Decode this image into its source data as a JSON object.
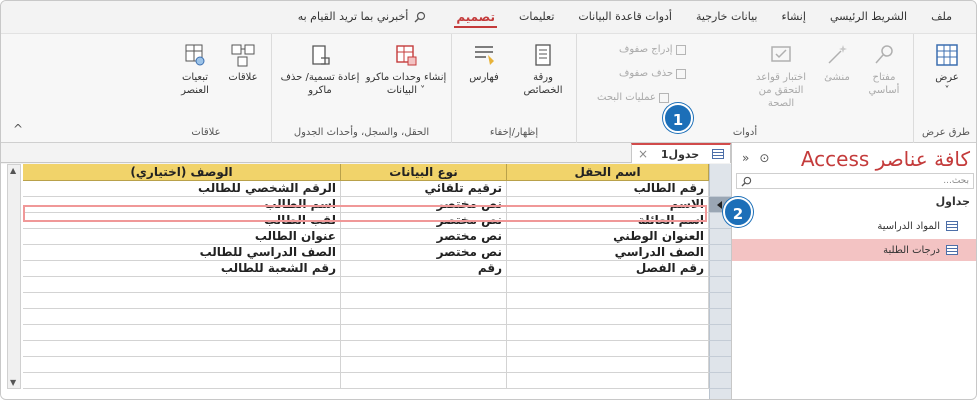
{
  "tabs": {
    "file": "ملف",
    "home": "الشريط الرئيسي",
    "create": "إنشاء",
    "external": "بيانات خارجية",
    "dbtools": "أدوات قاعدة البيانات",
    "help": "تعليمات",
    "design": "تصميم",
    "tell_me": "أخبرني بما تريد القيام به"
  },
  "ribbon": {
    "views": {
      "view": "عرض",
      "group": "طرق عرض"
    },
    "tools": {
      "primary_key": "مفتاح أساسي",
      "builder": "منشئ",
      "test_rules": "اختبار قواعد التحقق من الصحة",
      "insert_rows": "إدراج صفوف",
      "delete_rows": "حذف صفوف",
      "modify_lookups": "عمليات البحث",
      "group": "أدوات"
    },
    "show_hide": {
      "property_sheet": "ورقة الخصائص",
      "indexes": "فهارس",
      "group": "إظهار/إخفاء"
    },
    "field_events": {
      "create_macros": "إنشاء وحدات ماكرو البيانات",
      "rename_macro": "إعادة تسمية/ حذف ماكرو",
      "group": "الحقل، والسجل، وأحداث الجدول"
    },
    "relationships": {
      "relationships": "علاقات",
      "dependencies": "تبعيات العنصر",
      "group": "علاقات"
    }
  },
  "doc_tab": {
    "label": "جدول1"
  },
  "table": {
    "headers": {
      "field_name": "اسم الحقل",
      "data_type": "نوع البيانات",
      "description": "الوصف (اختياري)"
    },
    "rows": [
      {
        "field": "رقم الطالب",
        "type": "ترقيم تلقائي",
        "desc": "الرقم الشخصي للطالب"
      },
      {
        "field": "الاسم",
        "type": "نص مختصر",
        "desc": "اسم الطالب"
      },
      {
        "field": "اسم العائلة",
        "type": "نص مختصر",
        "desc": "لقب الطالب"
      },
      {
        "field": "العنوان الوطني",
        "type": "نص مختصر",
        "desc": "عنوان الطالب"
      },
      {
        "field": "الصف الدراسي",
        "type": "نص مختصر",
        "desc": "الصف الدراسي للطالب"
      },
      {
        "field": "رقم الفصل",
        "type": "رقم",
        "desc": "رقم الشعبة للطالب"
      }
    ]
  },
  "nav": {
    "title": "كافة عناصر Access",
    "search_placeholder": "بحث...",
    "section": "جداول",
    "items": [
      "المواد الدراسية",
      "درجات الطلبة"
    ]
  },
  "callouts": [
    "1",
    "2"
  ],
  "colors": {
    "accent": "#c43b3b",
    "header": "#f1d36a",
    "callout": "#1c6fb8",
    "selected_nav": "#f3c3c3"
  }
}
